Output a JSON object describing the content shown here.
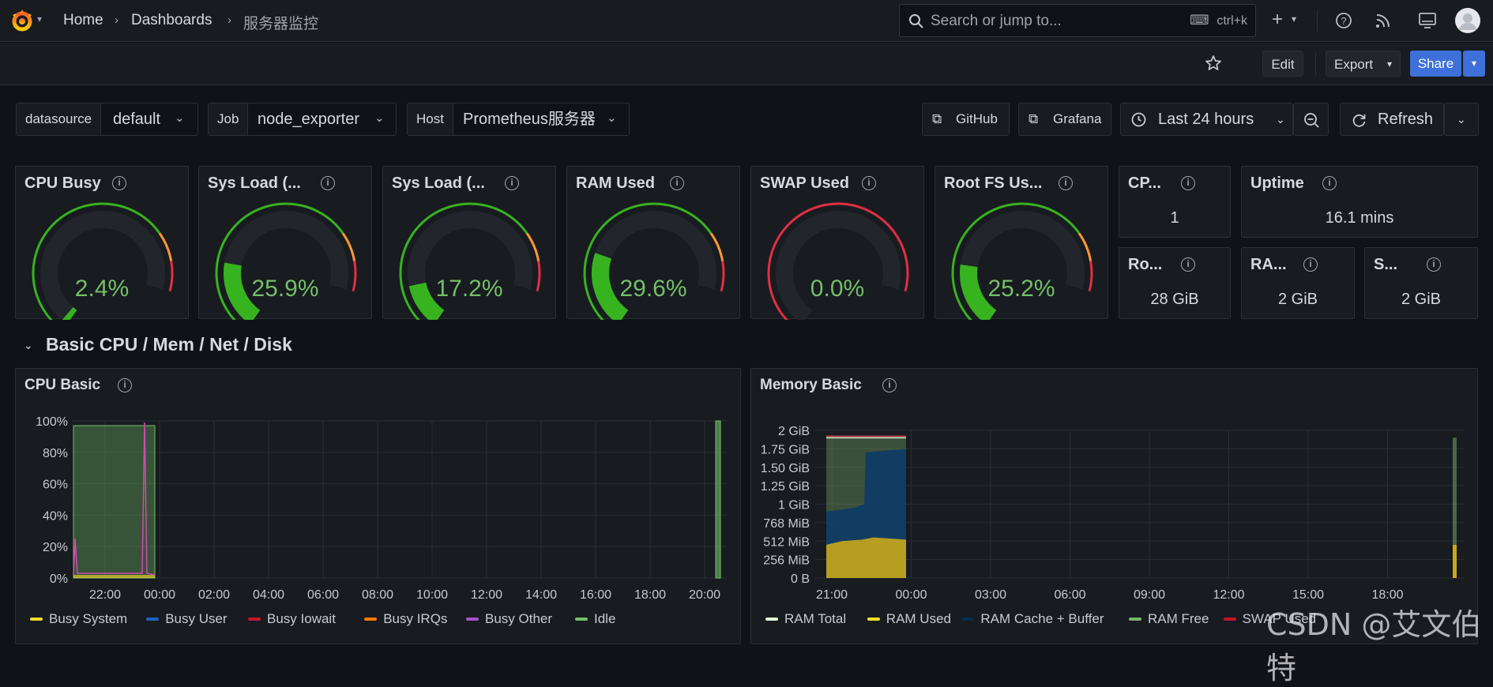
{
  "breadcrumb": {
    "home": "Home",
    "dashboards": "Dashboards",
    "current": "服务器监控"
  },
  "search": {
    "placeholder": "Search or jump to...",
    "shortcut": "ctrl+k"
  },
  "toolbar": {
    "edit": "Edit",
    "export": "Export",
    "share": "Share"
  },
  "variables": [
    {
      "label": "datasource",
      "value": "default"
    },
    {
      "label": "Job",
      "value": "node_exporter"
    },
    {
      "label": "Host",
      "value": "Prometheus服务器"
    }
  ],
  "links": {
    "github": "GitHub",
    "grafana": "Grafana"
  },
  "time_range": "Last 24 hours",
  "refresh": "Refresh",
  "gauges": [
    {
      "title": "CPU Busy",
      "value": "2.4%",
      "fraction": 0.024
    },
    {
      "title": "Sys Load (...",
      "value": "25.9%",
      "fraction": 0.259
    },
    {
      "title": "Sys Load (...",
      "value": "17.2%",
      "fraction": 0.172
    },
    {
      "title": "RAM Used",
      "value": "29.6%",
      "fraction": 0.296
    },
    {
      "title": "SWAP Used",
      "value": "0.0%",
      "fraction": 0.0
    },
    {
      "title": "Root FS Us...",
      "value": "25.2%",
      "fraction": 0.252
    }
  ],
  "stats": [
    {
      "title": "CP...",
      "value": "1"
    },
    {
      "title": "Uptime",
      "value": "16.1 mins"
    },
    {
      "title": "Ro...",
      "value": "28 GiB"
    },
    {
      "title": "RA...",
      "value": "2 GiB"
    },
    {
      "title": "S...",
      "value": "2 GiB"
    }
  ],
  "section_title": "Basic CPU / Mem / Net / Disk",
  "colors": {
    "green": "#73bf69",
    "red": "#f2495c",
    "orange": "#ff9830",
    "yellow": "#fade2a",
    "blue": "#1f60c4",
    "bg": "#111217",
    "panel": "#181b1f"
  },
  "cpu_panel": {
    "title": "CPU Basic",
    "legend": [
      {
        "name": "Busy System",
        "color": "#fade2a"
      },
      {
        "name": "Busy User",
        "color": "#1f60c4"
      },
      {
        "name": "Busy Iowait",
        "color": "#c4162a"
      },
      {
        "name": "Busy IRQs",
        "color": "#ff780a"
      },
      {
        "name": "Busy Other",
        "color": "#a352cc"
      },
      {
        "name": "Idle",
        "color": "#73bf69"
      }
    ]
  },
  "mem_panel": {
    "title": "Memory Basic",
    "legend": [
      {
        "name": "RAM Total",
        "color": "#e0f9d7"
      },
      {
        "name": "RAM Used",
        "color": "#fade2a"
      },
      {
        "name": "RAM Cache + Buffer",
        "color": "#052b51"
      },
      {
        "name": "RAM Free",
        "color": "#7eb26d"
      },
      {
        "name": "SWAP Used",
        "color": "#c4162a"
      }
    ]
  },
  "chart_data": [
    {
      "type": "area",
      "title": "CPU Basic",
      "x": [
        "22:00",
        "00:00",
        "02:00",
        "04:00",
        "06:00",
        "08:00",
        "10:00",
        "12:00",
        "14:00",
        "16:00",
        "18:00",
        "20:00"
      ],
      "y_ticks": [
        "0%",
        "20%",
        "40%",
        "60%",
        "80%",
        "100%"
      ],
      "ylim": [
        0,
        100
      ],
      "series": [
        {
          "name": "Idle",
          "values_note_time": [
            "20:50",
            "00:00",
            "20:40"
          ],
          "values": [
            97,
            97,
            100
          ]
        },
        {
          "name": "Busy System",
          "values": [
            2,
            2,
            0
          ]
        },
        {
          "name": "Busy Other",
          "values": [
            1,
            99,
            0
          ]
        }
      ]
    },
    {
      "type": "area",
      "title": "Memory Basic",
      "x": [
        "21:00",
        "00:00",
        "03:00",
        "06:00",
        "09:00",
        "12:00",
        "15:00",
        "18:00"
      ],
      "y_ticks": [
        "0 B",
        "256 MiB",
        "512 MiB",
        "768 MiB",
        "1 GiB",
        "1.25 GiB",
        "1.50 GiB",
        "1.75 GiB",
        "2 GiB"
      ],
      "ylim": [
        0,
        2
      ],
      "series": [
        {
          "name": "RAM Total",
          "values": [
            1.9,
            1.9,
            1.9
          ]
        },
        {
          "name": "RAM Used",
          "values": [
            0.5,
            0.55,
            0.45
          ]
        },
        {
          "name": "RAM Cache + Buffer",
          "values": [
            0.5,
            1.25,
            0.45
          ]
        },
        {
          "name": "RAM Free",
          "values": [
            0.9,
            0.1,
            1.0
          ]
        }
      ]
    }
  ],
  "watermark": "CSDN @艾文伯特"
}
